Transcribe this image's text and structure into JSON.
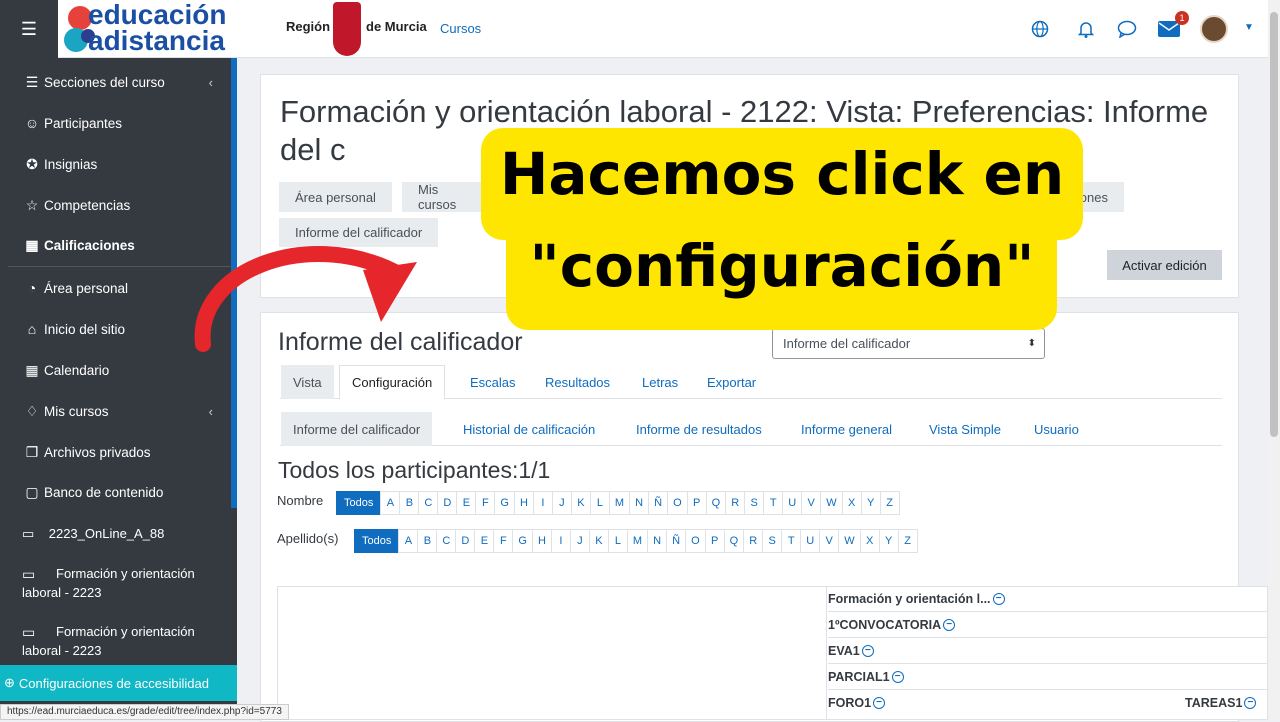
{
  "topbar": {
    "logo_line1": "educación",
    "logo_line2": "adistancia",
    "region": "Región",
    "murcia": "de Murcia",
    "cursos": "Cursos",
    "notification_badge": "1"
  },
  "sidebar": {
    "items": [
      {
        "label": "Secciones del curso",
        "icon": "list-icon"
      },
      {
        "label": "Participantes",
        "icon": "users-icon"
      },
      {
        "label": "Insignias",
        "icon": "badge-icon"
      },
      {
        "label": "Competencias",
        "icon": "star-icon"
      },
      {
        "label": "Calificaciones",
        "icon": "table-icon"
      },
      {
        "label": "Área personal",
        "icon": "dashboard-icon"
      },
      {
        "label": "Inicio del sitio",
        "icon": "home-icon"
      },
      {
        "label": "Calendario",
        "icon": "calendar-icon"
      },
      {
        "label": "Mis cursos",
        "icon": "graduation-cap-icon"
      },
      {
        "label": "Archivos privados",
        "icon": "files-icon"
      },
      {
        "label": "Banco de contenido",
        "icon": "clipboard-icon"
      }
    ],
    "folders": [
      {
        "label": "2223_OnLine_A_88"
      },
      {
        "label": "Formación y orientación laboral - 2223"
      },
      {
        "label": "Formación y orientación laboral - 2223"
      }
    ],
    "accessibility": "Configuraciones de accesibilidad"
  },
  "status_url": "https://ead.murciaeduca.es/grade/edit/tree/index.php?id=5773",
  "header": {
    "title": "Formación y orientación laboral - 2122: Vista: Preferencias: Informe del c",
    "breadcrumbs": [
      "Área personal",
      "Mis cursos",
      "ones",
      "Informe del calificador"
    ],
    "edit_button": "Activar edición"
  },
  "main": {
    "title": "Informe del calificador",
    "select_value": "Informe del calificador",
    "tabs": [
      "Vista",
      "Configuración",
      "Escalas",
      "Resultados",
      "Letras",
      "Exportar"
    ],
    "subtabs": [
      "Informe del calificador",
      "Historial de calificación",
      "Informe de resultados",
      "Informe general",
      "Vista Simple",
      "Usuario"
    ],
    "participants": "Todos los participantes:1/1",
    "nombre_label": "Nombre",
    "apellido_label": "Apellido(s)",
    "all_label": "Todos",
    "letters": [
      "A",
      "B",
      "C",
      "D",
      "E",
      "F",
      "G",
      "H",
      "I",
      "J",
      "K",
      "L",
      "M",
      "N",
      "Ñ",
      "O",
      "P",
      "Q",
      "R",
      "S",
      "T",
      "U",
      "V",
      "W",
      "X",
      "Y",
      "Z"
    ],
    "grid_rows": [
      "Formación y orientación l...",
      "1ºCONVOCATORIA",
      "EVA1",
      "PARCIAL1",
      "FORO1",
      "TAREAS1"
    ]
  },
  "callout": {
    "line1": "Hacemos click en",
    "line2": "\"configuración\""
  },
  "colors": {
    "accent": "#0f6cbf",
    "sidebar": "#343a40",
    "callout": "#ffe600",
    "arrow": "#e5262a"
  }
}
